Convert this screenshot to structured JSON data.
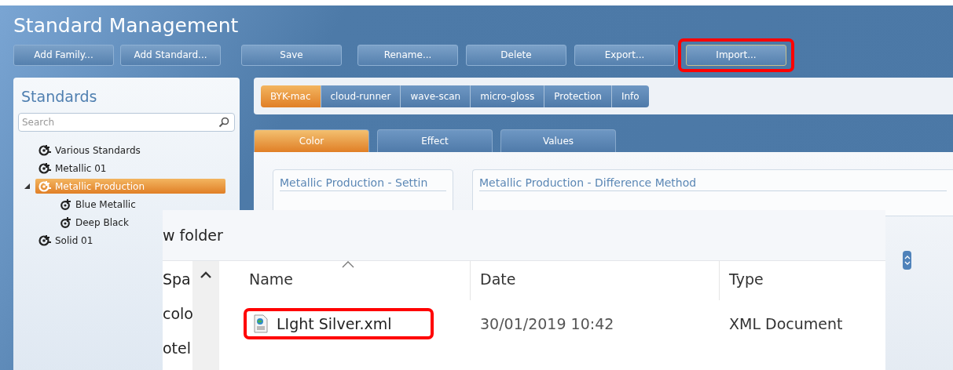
{
  "window": {
    "title": "Standard Management"
  },
  "toolbar": [
    {
      "label": "Add Family...",
      "highlighted": false
    },
    {
      "label": "Add Standard...",
      "highlighted": false
    },
    {
      "label": "Save",
      "highlighted": false
    },
    {
      "label": "Rename...",
      "highlighted": false
    },
    {
      "label": "Delete",
      "highlighted": false
    },
    {
      "label": "Export...",
      "highlighted": false
    },
    {
      "label": "Import...",
      "highlighted": true
    }
  ],
  "standards_panel": {
    "title": "Standards",
    "search": {
      "placeholder": "Search"
    },
    "tree": [
      {
        "label": "Various Standards",
        "selected": false
      },
      {
        "label": "Metallic 01",
        "selected": false
      },
      {
        "label": "Metallic Production",
        "selected": true,
        "expanded": true,
        "children": [
          {
            "label": "Blue Metallic",
            "selected": false
          },
          {
            "label": "Deep Black",
            "selected": false
          }
        ]
      },
      {
        "label": "Solid 01",
        "selected": false
      }
    ]
  },
  "device_tabs": [
    {
      "label": "BYK-mac",
      "selected": true
    },
    {
      "label": "cloud-runner",
      "selected": false
    },
    {
      "label": "wave-scan",
      "selected": false
    },
    {
      "label": "micro-gloss",
      "selected": false
    },
    {
      "label": "Protection",
      "selected": false
    },
    {
      "label": "Info",
      "selected": false
    }
  ],
  "view_tabs": [
    {
      "label": "Color",
      "selected": true
    },
    {
      "label": "Effect",
      "selected": false
    },
    {
      "label": "Values",
      "selected": false
    }
  ],
  "groups": [
    {
      "title": "Metallic Production - Settin"
    },
    {
      "title": "Metallic Production - Difference Method"
    }
  ],
  "file_dialog": {
    "breadcrumb": "w folder",
    "nav_items": [
      "Spa",
      "colo",
      "otel"
    ],
    "columns": [
      {
        "label": "Name",
        "sorted": true
      },
      {
        "label": "Date",
        "sorted": false
      },
      {
        "label": "Type",
        "sorted": false
      }
    ],
    "files": [
      {
        "name": "LIght Silver.xml",
        "date": "30/01/2019 10:42",
        "type": "XML Document",
        "highlighted": true
      }
    ]
  }
}
